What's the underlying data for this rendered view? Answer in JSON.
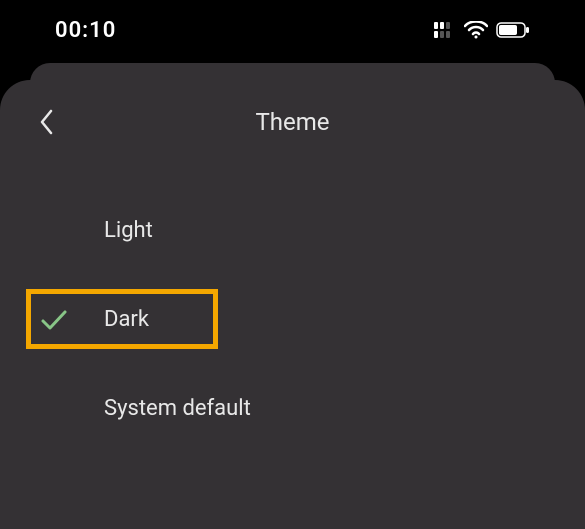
{
  "status_bar": {
    "time": "00:10"
  },
  "header": {
    "title": "Theme"
  },
  "options": [
    {
      "label": "Light",
      "selected": false,
      "highlighted": false
    },
    {
      "label": "Dark",
      "selected": true,
      "highlighted": true
    },
    {
      "label": "System default",
      "selected": false,
      "highlighted": false
    }
  ],
  "colors": {
    "background": "#000000",
    "panel": "#343134",
    "text": "#e8e8e8",
    "check": "#88c587",
    "highlight": "#f4a700"
  }
}
